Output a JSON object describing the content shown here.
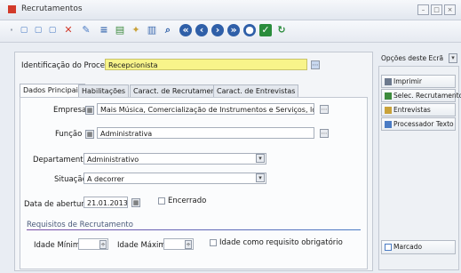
{
  "window": {
    "title": "Recrutamentos"
  },
  "header": {
    "process_label": "Identificação do Processo",
    "process_value": "Recepcionista"
  },
  "tabs": [
    {
      "label": "Dados Principais"
    },
    {
      "label": "Habilitações"
    },
    {
      "label": "Caract. de Recrutamento"
    },
    {
      "label": "Caract. de Entrevistas"
    }
  ],
  "form": {
    "empresa_label": "Empresa",
    "empresa_value": "Mais Música, Comercialização de Instrumentos e Serviços, lda",
    "funcao_label": "Função",
    "funcao_value": "Administrativa",
    "departamento_label": "Departamento",
    "departamento_value": "Administrativo",
    "situacao_label": "Situação",
    "situacao_value": "A decorrer",
    "data_label": "Data de abertura",
    "data_value": "21.01.2013",
    "encerrado_label": "Encerrado",
    "requisitos_title": "Requisitos de Recrutamento",
    "idade_min_label": "Idade Mínima",
    "idade_max_label": "Idade Máxima",
    "idade_req_label": "Idade como requisito obrigatório"
  },
  "sidebar": {
    "options_label": "Opções deste Ecrã",
    "buttons": [
      {
        "label": "Imprimir"
      },
      {
        "label": "Selec. Recrutamento"
      },
      {
        "label": "Entrevistas"
      },
      {
        "label": "Processador Texto"
      }
    ],
    "marcado_label": "Marcado"
  },
  "colors": {
    "highlight": "#f8f48a",
    "accent": "#d23a2a"
  },
  "icons": [
    "new-icon",
    "open-icon",
    "copy-icon",
    "delete-icon",
    "edit-icon",
    "list-icon",
    "export-icon",
    "search-icon",
    "first-icon",
    "prev-icon",
    "next-icon",
    "last-icon",
    "save-icon",
    "refresh-icon"
  ]
}
